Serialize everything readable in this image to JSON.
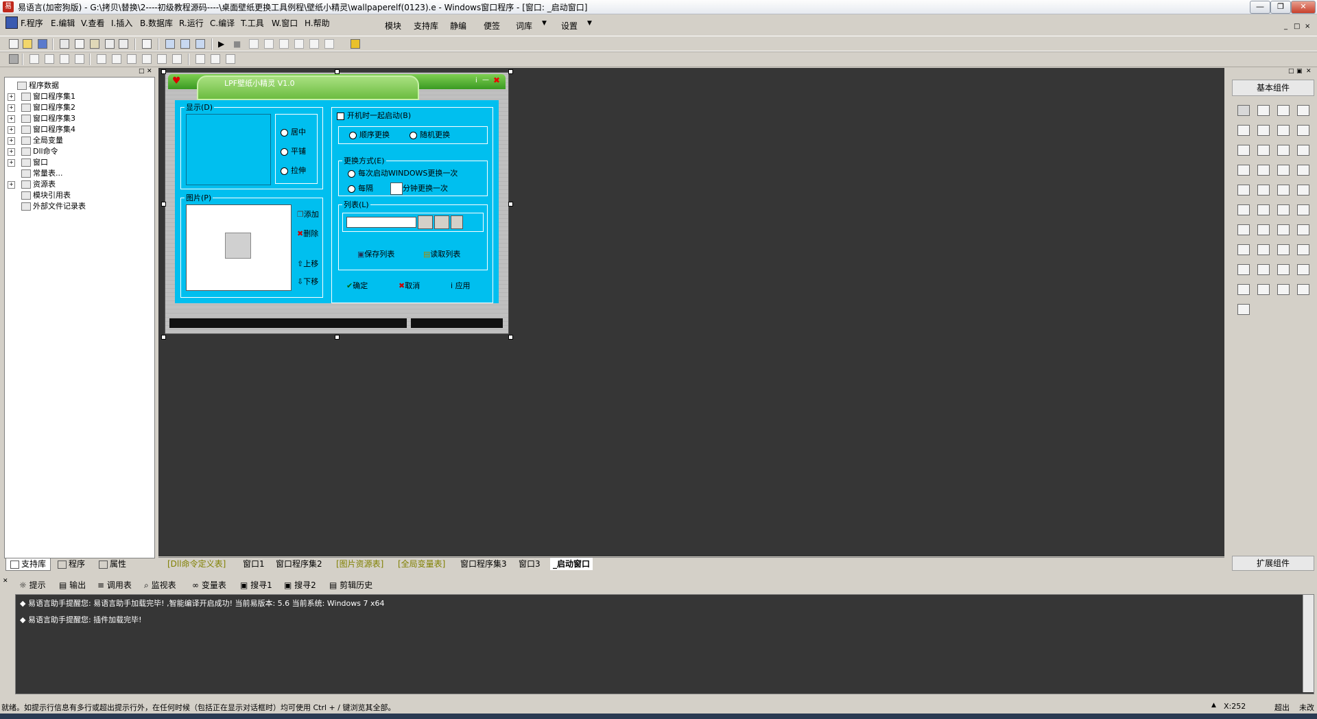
{
  "app": {
    "title": "易语言(加密狗版) - G:\\拷贝\\替换\\2----初级教程源码----\\桌面壁纸更换工具例程\\壁纸小精灵\\wallpaperelf(0123).e - Windows窗口程序 - [窗口: _启动窗口]",
    "icon_text": "易",
    "controls": [
      "minimize-icon",
      "restore-icon",
      "close-icon"
    ]
  },
  "menu": {
    "left": [
      "F.程序",
      "E.编辑",
      "V.查看",
      "I.插入",
      "B.数据库",
      "R.运行",
      "C.编译",
      "T.工具",
      "W.窗口",
      "H.帮助"
    ],
    "right": [
      "模块",
      "支持库",
      "静编",
      "便签",
      "词库",
      "设置"
    ],
    "mdi_controls": [
      "_",
      "□",
      "×"
    ]
  },
  "left_panel": {
    "tree": [
      {
        "label": "程序数据",
        "level": 0,
        "expander": ""
      },
      {
        "label": "窗口程序集1",
        "level": 1,
        "expander": "+"
      },
      {
        "label": "窗口程序集2",
        "level": 1,
        "expander": "+"
      },
      {
        "label": "窗口程序集3",
        "level": 1,
        "expander": "+"
      },
      {
        "label": "窗口程序集4",
        "level": 1,
        "expander": "+"
      },
      {
        "label": "全局变量",
        "level": 1,
        "expander": "+"
      },
      {
        "label": "Dll命令",
        "level": 1,
        "expander": "+"
      },
      {
        "label": "窗口",
        "level": 1,
        "expander": "+"
      },
      {
        "label": "常量表...",
        "level": 1,
        "expander": ""
      },
      {
        "label": "资源表",
        "level": 1,
        "expander": "+"
      },
      {
        "label": "模块引用表",
        "level": 1,
        "expander": ""
      },
      {
        "label": "外部文件记录表",
        "level": 1,
        "expander": ""
      }
    ],
    "tabs": [
      "支持库",
      "程序",
      "属性"
    ]
  },
  "form": {
    "title": "LPF壁纸小精灵 V1.0",
    "display_group": "显示(D)",
    "display_options": [
      "居中",
      "平铺",
      "拉伸"
    ],
    "picture_group": "图片(P)",
    "picture_buttons": [
      "添加",
      "删除",
      "上移",
      "下移"
    ],
    "startup_checkbox": "开机时一起启动(B)",
    "order_options": [
      "顺序更换",
      "随机更换"
    ],
    "change_group": "更换方式(E)",
    "change_options": [
      "每次启动WINDOWS更换一次",
      "每隔",
      "分钟更换一次"
    ],
    "list_group": "列表(L)",
    "list_buttons": [
      "保存列表",
      "读取列表"
    ],
    "footer_buttons": [
      "确定",
      "取消",
      "应用"
    ]
  },
  "right_panel": {
    "header": "基本组件",
    "footer": "扩展组件"
  },
  "editor_tabs": [
    "[Dll命令定义表]",
    "窗口1",
    "窗口程序集2",
    "[图片资源表]",
    "[全局变量表]",
    "窗口程序集3",
    "窗口3",
    "_启动窗口"
  ],
  "output_tabs": [
    "提示",
    "输出",
    "调用表",
    "监视表",
    "变量表",
    "搜寻1",
    "搜寻2",
    "剪辑历史"
  ],
  "output_lines": [
    "易语言助手提醒您: 易语言助手加载完毕! ,智能编译开启成功! 当前易版本: 5.6 当前系统: Windows 7 x64",
    "易语言助手提醒您: 插件加载完毕!"
  ],
  "status": {
    "message": "就绪。如提示行信息有多行或超出提示行外，在任何时候（包括正在显示对话框时）均可使用 Ctrl + / 键浏览其全部。",
    "coord": "X:252",
    "mode1": "超出",
    "mode2": "未改"
  },
  "colors": {
    "form_cyan": "#00bfef",
    "form_green": "#58b23a",
    "canvas": "#363636",
    "output_bg": "#363636"
  }
}
